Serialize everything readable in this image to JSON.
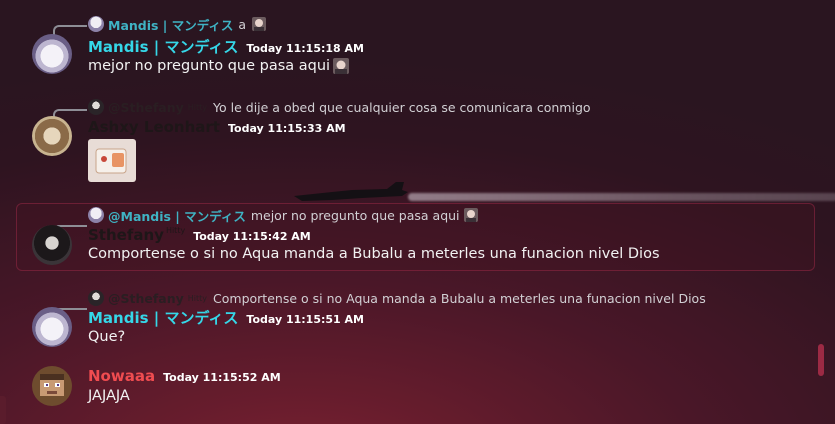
{
  "messages": [
    {
      "reply": {
        "author": "Mandis | マンディス",
        "text": "a"
      },
      "author": "Mandis | マンディス",
      "time": "Today 11:15:18 AM",
      "text": "mejor no pregunto que pasa aqui"
    },
    {
      "reply": {
        "author": "@Sthefany",
        "tag": "Hitty",
        "text": "Yo le dije a obed que cualquier cosa se comunicara conmigo"
      },
      "author": "Ashxy Leonhart",
      "time": "Today 11:15:33 AM",
      "text": ""
    },
    {
      "reply": {
        "author": "@Mandis | マンディス",
        "text": "mejor no pregunto que pasa aqui"
      },
      "author": "Sthefany",
      "tag": "Hitty",
      "time": "Today 11:15:42 AM",
      "text": "Comportense o si no Aqua manda a Bubalu a meterles una funacion nivel Dios",
      "highlighted": true
    },
    {
      "reply": {
        "author": "@Sthefany",
        "tag": "Hitty",
        "text": "Comportense o si no Aqua manda a Bubalu a meterles una funacion nivel Dios"
      },
      "author": "Mandis | マンディス",
      "time": "Today 11:15:51 AM",
      "text": "Que?"
    },
    {
      "author": "Nowaaa",
      "time": "Today 11:15:52 AM",
      "text": "JAJAJA"
    }
  ],
  "colors": {
    "mention": "#3fb3c4",
    "name_cyan": "#35d7e8",
    "name_red": "#f04c50",
    "highlight_border": "#962846"
  },
  "icons": [
    "avatar",
    "emoji-image",
    "sticker-image",
    "jet-plane"
  ]
}
